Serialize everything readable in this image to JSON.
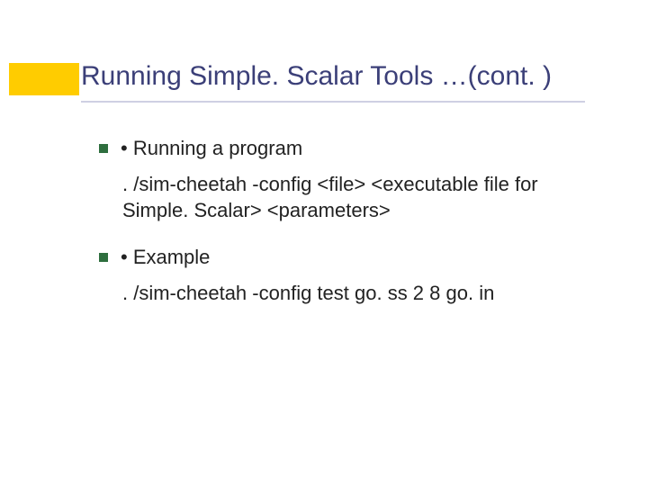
{
  "title": "Running Simple. Scalar Tools …(cont. )",
  "items": [
    {
      "heading": "• Running a program",
      "detail": ". /sim-cheetah -config <file> <executable file for Simple. Scalar> <parameters>"
    },
    {
      "heading": "• Example",
      "detail": ". /sim-cheetah -config test go. ss 2 8 go. in"
    }
  ]
}
